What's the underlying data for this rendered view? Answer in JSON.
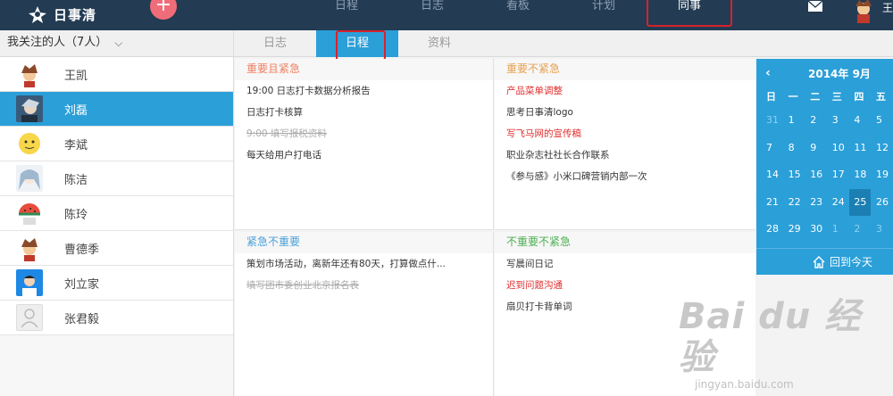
{
  "app": {
    "logo_text": "日事清",
    "add_symbol": "+"
  },
  "nav": {
    "items": [
      "日程",
      "日志",
      "看板",
      "计划",
      "同事"
    ],
    "active_index": 4
  },
  "user": {
    "name": "王"
  },
  "sidebar": {
    "header": "我关注的人（7人）",
    "people": [
      {
        "name": "王凯",
        "avatar": "cartoon-boy-avatar"
      },
      {
        "name": "刘磊",
        "avatar": "anime-hero-avatar"
      },
      {
        "name": "李斌",
        "avatar": "emoji-face-avatar"
      },
      {
        "name": "陈洁",
        "avatar": "anime-girl-avatar"
      },
      {
        "name": "陈玲",
        "avatar": "watermelon-avatar"
      },
      {
        "name": "曹德季",
        "avatar": "cartoon-boy-avatar"
      },
      {
        "name": "刘立家",
        "avatar": "photo-avatar"
      },
      {
        "name": "张君毅",
        "avatar": "default-avatar"
      }
    ],
    "active_index": 1
  },
  "tabs": {
    "items": [
      "日志",
      "日程",
      "资料"
    ],
    "active_index": 1
  },
  "quadrants": {
    "q1": {
      "title": "重要且紧急",
      "color": "#f08060",
      "items": [
        {
          "text": "19:00 日志打卡数据分析报告",
          "style": "normal"
        },
        {
          "text": "日志打卡核算",
          "style": "normal"
        },
        {
          "text": "9:00 填写报税资料",
          "style": "strike"
        },
        {
          "text": "每天给用户打电话",
          "style": "normal"
        }
      ]
    },
    "q2": {
      "title": "重要不紧急",
      "color": "#e8a050",
      "items": [
        {
          "text": "产品菜单调整",
          "style": "red"
        },
        {
          "text": "思考日事清logo",
          "style": "normal"
        },
        {
          "text": "写飞马网的宣传稿",
          "style": "red"
        },
        {
          "text": "职业杂志社社长合作联系",
          "style": "normal"
        },
        {
          "text": "《参与感》小米口碑营销内部一次",
          "style": "normal"
        }
      ]
    },
    "q3": {
      "title": "紧急不重要",
      "color": "#4aa0d8",
      "items": [
        {
          "text": "策划市场活动，离新年还有80天，打算做点什...",
          "style": "normal"
        },
        {
          "text": "填写团市委创业北京报名表",
          "style": "strike"
        }
      ]
    },
    "q4": {
      "title": "不重要不紧急",
      "color": "#4caf50",
      "items": [
        {
          "text": "写晨间日记",
          "style": "normal"
        },
        {
          "text": "迟到问题沟通",
          "style": "red"
        },
        {
          "text": "扇贝打卡背单词",
          "style": "normal"
        }
      ]
    }
  },
  "calendar": {
    "title": "2014年 9月",
    "prev_symbol": "‹",
    "weekdays": [
      "日",
      "一",
      "二",
      "三",
      "四",
      "五"
    ],
    "weeks": [
      [
        "31",
        "1",
        "2",
        "3",
        "4",
        "5"
      ],
      [
        "7",
        "8",
        "9",
        "10",
        "11",
        "12"
      ],
      [
        "14",
        "15",
        "16",
        "17",
        "18",
        "19"
      ],
      [
        "21",
        "22",
        "23",
        "24",
        "25",
        "26"
      ],
      [
        "28",
        "29",
        "30",
        "1",
        "2",
        "3"
      ]
    ],
    "today": "25",
    "back_today_label": "回到今天"
  },
  "watermark": {
    "brand": "Bai du 经验",
    "url": "jingyan.baidu.com"
  }
}
